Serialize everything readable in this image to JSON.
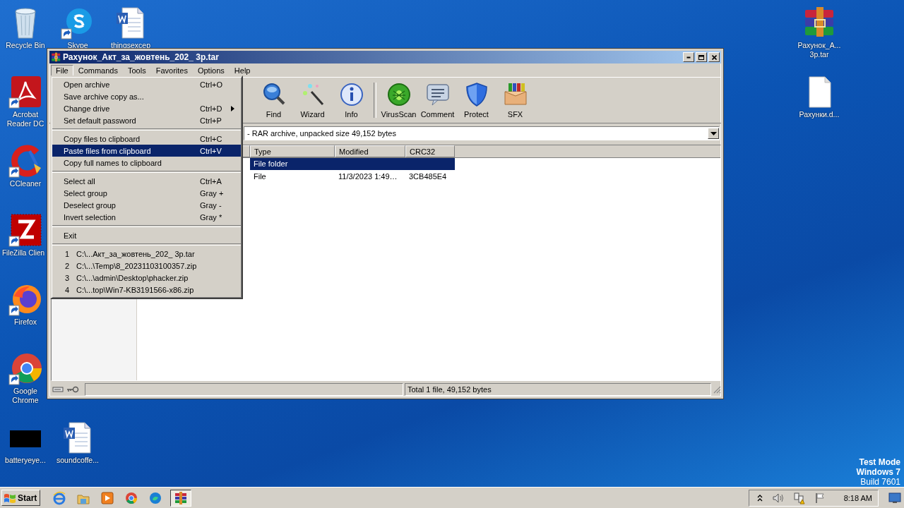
{
  "desktop_icons": [
    {
      "label": "Recycle Bin",
      "kind": "recycle",
      "shortcut": false
    },
    {
      "label": "Skype",
      "kind": "skype",
      "shortcut": true
    },
    {
      "label": "thingsexcep",
      "kind": "word",
      "shortcut": false
    },
    {
      "label": "Acrobat Reader DC",
      "kind": "pdf",
      "shortcut": true
    },
    {
      "label": "CCleaner",
      "kind": "ccleaner",
      "shortcut": true
    },
    {
      "label": "FileZilla Clien",
      "kind": "filezilla",
      "shortcut": true
    },
    {
      "label": "Firefox",
      "kind": "firefox",
      "shortcut": true
    },
    {
      "label": "Google Chrome",
      "kind": "chrome",
      "shortcut": true
    },
    {
      "label": "batteryeye...",
      "kind": "black",
      "shortcut": false
    },
    {
      "label": "soundcoffe...",
      "kind": "word",
      "shortcut": false
    },
    {
      "label": "Рахунок_А... 3p.tar",
      "kind": "rar",
      "shortcut": false
    },
    {
      "label": "Рахунки.d...",
      "kind": "blank",
      "shortcut": false
    }
  ],
  "window": {
    "title": "Рахунок_Акт_за_жовтень_202_ 3p.tar",
    "menu": [
      {
        "label": "File",
        "selected": true
      },
      {
        "label": "Commands",
        "selected": false
      },
      {
        "label": "Tools",
        "selected": false
      },
      {
        "label": "Favorites",
        "selected": false
      },
      {
        "label": "Options",
        "selected": false
      },
      {
        "label": "Help",
        "selected": false
      }
    ],
    "toolbar": {
      "groups": [
        [
          {
            "label": "Find",
            "kind": "find"
          },
          {
            "label": "Wizard",
            "kind": "wizard"
          },
          {
            "label": "Info",
            "kind": "info"
          }
        ],
        [
          {
            "label": "VirusScan",
            "kind": "virusscan"
          },
          {
            "label": "Comment",
            "kind": "comment"
          },
          {
            "label": "Protect",
            "kind": "protect"
          },
          {
            "label": "SFX",
            "kind": "sfx"
          }
        ]
      ]
    },
    "address": "- RAR archive, unpacked size 49,152 bytes",
    "table": {
      "columns": [
        "Type",
        "Modified",
        "CRC32"
      ],
      "rows": [
        {
          "cells": [
            "File folder"
          ],
          "selected": true
        },
        {
          "cells": [
            "File",
            "11/3/2023 1:49…",
            "3CB485E4"
          ],
          "selected": false
        }
      ]
    },
    "status_bar": "Total 1 file, 49,152 bytes"
  },
  "file_menu": {
    "groups": [
      [
        {
          "label": "Open archive",
          "shortcut": "Ctrl+O",
          "submenu": false,
          "selected": false
        },
        {
          "label": "Save archive copy as...",
          "submenu": false,
          "selected": false
        },
        {
          "label": "Change drive",
          "shortcut": "Ctrl+D",
          "submenu": true,
          "selected": false
        },
        {
          "label": "Set default password",
          "shortcut": "Ctrl+P",
          "submenu": false,
          "selected": false
        }
      ],
      [
        {
          "label": "Copy files to clipboard",
          "shortcut": "Ctrl+C",
          "submenu": false,
          "selected": false
        },
        {
          "label": "Paste files from clipboard",
          "shortcut": "Ctrl+V",
          "submenu": false,
          "selected": true
        },
        {
          "label": "Copy full names to clipboard",
          "submenu": false,
          "selected": false
        }
      ],
      [
        {
          "label": "Select all",
          "shortcut": "Ctrl+A",
          "submenu": false,
          "selected": false
        },
        {
          "label": "Select group",
          "shortcut": "Gray +",
          "submenu": false,
          "selected": false
        },
        {
          "label": "Deselect group",
          "shortcut": "Gray -",
          "submenu": false,
          "selected": false
        },
        {
          "label": "Invert selection",
          "shortcut": "Gray *",
          "submenu": false,
          "selected": false
        }
      ],
      [
        {
          "label": "Exit",
          "submenu": false,
          "selected": false
        }
      ]
    ],
    "recent": [
      {
        "number": "1",
        "path": "C:\\...Акт_за_жовтень_202_ 3p.tar"
      },
      {
        "number": "2",
        "path": "C:\\...\\Temp\\8_20231103100357.zip"
      },
      {
        "number": "3",
        "path": "C:\\...\\admin\\Desktop\\phacker.zip"
      },
      {
        "number": "4",
        "path": "C:\\...top\\Win7-KB3191566-x86.zip"
      }
    ]
  },
  "taskbar": {
    "start": "Start",
    "apps": [
      {
        "kind": "ie",
        "active": false
      },
      {
        "kind": "explorer",
        "active": false
      },
      {
        "kind": "media",
        "active": false
      },
      {
        "kind": "chrome",
        "active": false
      },
      {
        "kind": "edge",
        "active": false
      },
      {
        "kind": "winrar",
        "active": true
      }
    ],
    "clock": "8:18 AM"
  },
  "system_text": [
    "Test Mode",
    "Windows 7",
    "Build 7601"
  ]
}
